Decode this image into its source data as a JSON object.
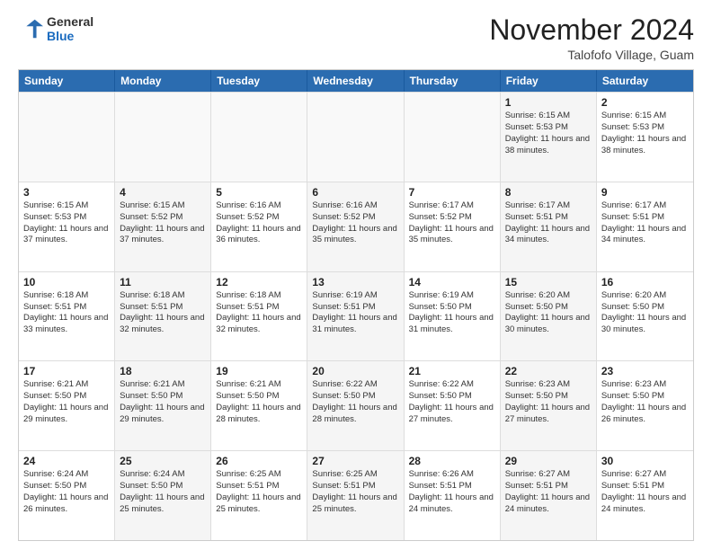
{
  "logo": {
    "general": "General",
    "blue": "Blue"
  },
  "header": {
    "month": "November 2024",
    "location": "Talofofo Village, Guam"
  },
  "days_of_week": [
    "Sunday",
    "Monday",
    "Tuesday",
    "Wednesday",
    "Thursday",
    "Friday",
    "Saturday"
  ],
  "rows": [
    [
      {
        "day": "",
        "empty": true
      },
      {
        "day": "",
        "empty": true
      },
      {
        "day": "",
        "empty": true
      },
      {
        "day": "",
        "empty": true
      },
      {
        "day": "",
        "empty": true
      },
      {
        "day": "1",
        "sunrise": "Sunrise: 6:15 AM",
        "sunset": "Sunset: 5:53 PM",
        "daylight": "Daylight: 11 hours and 38 minutes."
      },
      {
        "day": "2",
        "sunrise": "Sunrise: 6:15 AM",
        "sunset": "Sunset: 5:53 PM",
        "daylight": "Daylight: 11 hours and 38 minutes."
      }
    ],
    [
      {
        "day": "3",
        "sunrise": "Sunrise: 6:15 AM",
        "sunset": "Sunset: 5:53 PM",
        "daylight": "Daylight: 11 hours and 37 minutes."
      },
      {
        "day": "4",
        "sunrise": "Sunrise: 6:15 AM",
        "sunset": "Sunset: 5:52 PM",
        "daylight": "Daylight: 11 hours and 37 minutes."
      },
      {
        "day": "5",
        "sunrise": "Sunrise: 6:16 AM",
        "sunset": "Sunset: 5:52 PM",
        "daylight": "Daylight: 11 hours and 36 minutes."
      },
      {
        "day": "6",
        "sunrise": "Sunrise: 6:16 AM",
        "sunset": "Sunset: 5:52 PM",
        "daylight": "Daylight: 11 hours and 35 minutes."
      },
      {
        "day": "7",
        "sunrise": "Sunrise: 6:17 AM",
        "sunset": "Sunset: 5:52 PM",
        "daylight": "Daylight: 11 hours and 35 minutes."
      },
      {
        "day": "8",
        "sunrise": "Sunrise: 6:17 AM",
        "sunset": "Sunset: 5:51 PM",
        "daylight": "Daylight: 11 hours and 34 minutes."
      },
      {
        "day": "9",
        "sunrise": "Sunrise: 6:17 AM",
        "sunset": "Sunset: 5:51 PM",
        "daylight": "Daylight: 11 hours and 34 minutes."
      }
    ],
    [
      {
        "day": "10",
        "sunrise": "Sunrise: 6:18 AM",
        "sunset": "Sunset: 5:51 PM",
        "daylight": "Daylight: 11 hours and 33 minutes."
      },
      {
        "day": "11",
        "sunrise": "Sunrise: 6:18 AM",
        "sunset": "Sunset: 5:51 PM",
        "daylight": "Daylight: 11 hours and 32 minutes."
      },
      {
        "day": "12",
        "sunrise": "Sunrise: 6:18 AM",
        "sunset": "Sunset: 5:51 PM",
        "daylight": "Daylight: 11 hours and 32 minutes."
      },
      {
        "day": "13",
        "sunrise": "Sunrise: 6:19 AM",
        "sunset": "Sunset: 5:51 PM",
        "daylight": "Daylight: 11 hours and 31 minutes."
      },
      {
        "day": "14",
        "sunrise": "Sunrise: 6:19 AM",
        "sunset": "Sunset: 5:50 PM",
        "daylight": "Daylight: 11 hours and 31 minutes."
      },
      {
        "day": "15",
        "sunrise": "Sunrise: 6:20 AM",
        "sunset": "Sunset: 5:50 PM",
        "daylight": "Daylight: 11 hours and 30 minutes."
      },
      {
        "day": "16",
        "sunrise": "Sunrise: 6:20 AM",
        "sunset": "Sunset: 5:50 PM",
        "daylight": "Daylight: 11 hours and 30 minutes."
      }
    ],
    [
      {
        "day": "17",
        "sunrise": "Sunrise: 6:21 AM",
        "sunset": "Sunset: 5:50 PM",
        "daylight": "Daylight: 11 hours and 29 minutes."
      },
      {
        "day": "18",
        "sunrise": "Sunrise: 6:21 AM",
        "sunset": "Sunset: 5:50 PM",
        "daylight": "Daylight: 11 hours and 29 minutes."
      },
      {
        "day": "19",
        "sunrise": "Sunrise: 6:21 AM",
        "sunset": "Sunset: 5:50 PM",
        "daylight": "Daylight: 11 hours and 28 minutes."
      },
      {
        "day": "20",
        "sunrise": "Sunrise: 6:22 AM",
        "sunset": "Sunset: 5:50 PM",
        "daylight": "Daylight: 11 hours and 28 minutes."
      },
      {
        "day": "21",
        "sunrise": "Sunrise: 6:22 AM",
        "sunset": "Sunset: 5:50 PM",
        "daylight": "Daylight: 11 hours and 27 minutes."
      },
      {
        "day": "22",
        "sunrise": "Sunrise: 6:23 AM",
        "sunset": "Sunset: 5:50 PM",
        "daylight": "Daylight: 11 hours and 27 minutes."
      },
      {
        "day": "23",
        "sunrise": "Sunrise: 6:23 AM",
        "sunset": "Sunset: 5:50 PM",
        "daylight": "Daylight: 11 hours and 26 minutes."
      }
    ],
    [
      {
        "day": "24",
        "sunrise": "Sunrise: 6:24 AM",
        "sunset": "Sunset: 5:50 PM",
        "daylight": "Daylight: 11 hours and 26 minutes."
      },
      {
        "day": "25",
        "sunrise": "Sunrise: 6:24 AM",
        "sunset": "Sunset: 5:50 PM",
        "daylight": "Daylight: 11 hours and 25 minutes."
      },
      {
        "day": "26",
        "sunrise": "Sunrise: 6:25 AM",
        "sunset": "Sunset: 5:51 PM",
        "daylight": "Daylight: 11 hours and 25 minutes."
      },
      {
        "day": "27",
        "sunrise": "Sunrise: 6:25 AM",
        "sunset": "Sunset: 5:51 PM",
        "daylight": "Daylight: 11 hours and 25 minutes."
      },
      {
        "day": "28",
        "sunrise": "Sunrise: 6:26 AM",
        "sunset": "Sunset: 5:51 PM",
        "daylight": "Daylight: 11 hours and 24 minutes."
      },
      {
        "day": "29",
        "sunrise": "Sunrise: 6:27 AM",
        "sunset": "Sunset: 5:51 PM",
        "daylight": "Daylight: 11 hours and 24 minutes."
      },
      {
        "day": "30",
        "sunrise": "Sunrise: 6:27 AM",
        "sunset": "Sunset: 5:51 PM",
        "daylight": "Daylight: 11 hours and 24 minutes."
      }
    ]
  ]
}
